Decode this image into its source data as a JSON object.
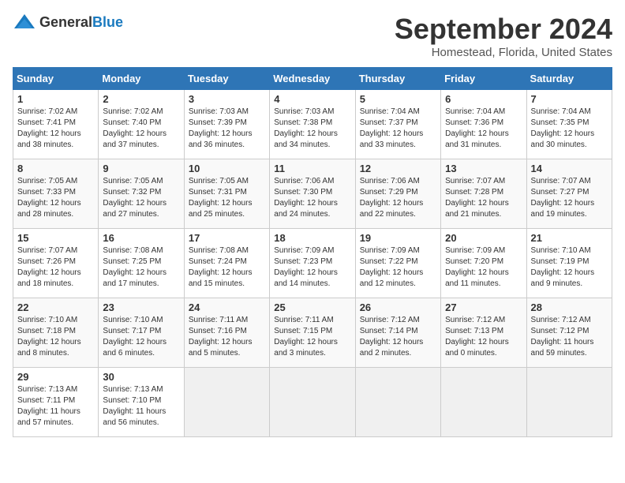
{
  "header": {
    "logo_general": "General",
    "logo_blue": "Blue",
    "title": "September 2024",
    "subtitle": "Homestead, Florida, United States"
  },
  "calendar": {
    "days_of_week": [
      "Sunday",
      "Monday",
      "Tuesday",
      "Wednesday",
      "Thursday",
      "Friday",
      "Saturday"
    ],
    "weeks": [
      [
        {
          "day": "",
          "empty": true
        },
        {
          "day": "",
          "empty": true
        },
        {
          "day": "",
          "empty": true
        },
        {
          "day": "",
          "empty": true
        },
        {
          "day": "",
          "empty": true
        },
        {
          "day": "",
          "empty": true
        },
        {
          "day": "",
          "empty": true
        }
      ],
      [
        {
          "day": "1",
          "info": "Sunrise: 7:02 AM\nSunset: 7:41 PM\nDaylight: 12 hours\nand 38 minutes."
        },
        {
          "day": "2",
          "info": "Sunrise: 7:02 AM\nSunset: 7:40 PM\nDaylight: 12 hours\nand 37 minutes."
        },
        {
          "day": "3",
          "info": "Sunrise: 7:03 AM\nSunset: 7:39 PM\nDaylight: 12 hours\nand 36 minutes."
        },
        {
          "day": "4",
          "info": "Sunrise: 7:03 AM\nSunset: 7:38 PM\nDaylight: 12 hours\nand 34 minutes."
        },
        {
          "day": "5",
          "info": "Sunrise: 7:04 AM\nSunset: 7:37 PM\nDaylight: 12 hours\nand 33 minutes."
        },
        {
          "day": "6",
          "info": "Sunrise: 7:04 AM\nSunset: 7:36 PM\nDaylight: 12 hours\nand 31 minutes."
        },
        {
          "day": "7",
          "info": "Sunrise: 7:04 AM\nSunset: 7:35 PM\nDaylight: 12 hours\nand 30 minutes."
        }
      ],
      [
        {
          "day": "8",
          "info": "Sunrise: 7:05 AM\nSunset: 7:33 PM\nDaylight: 12 hours\nand 28 minutes."
        },
        {
          "day": "9",
          "info": "Sunrise: 7:05 AM\nSunset: 7:32 PM\nDaylight: 12 hours\nand 27 minutes."
        },
        {
          "day": "10",
          "info": "Sunrise: 7:05 AM\nSunset: 7:31 PM\nDaylight: 12 hours\nand 25 minutes."
        },
        {
          "day": "11",
          "info": "Sunrise: 7:06 AM\nSunset: 7:30 PM\nDaylight: 12 hours\nand 24 minutes."
        },
        {
          "day": "12",
          "info": "Sunrise: 7:06 AM\nSunset: 7:29 PM\nDaylight: 12 hours\nand 22 minutes."
        },
        {
          "day": "13",
          "info": "Sunrise: 7:07 AM\nSunset: 7:28 PM\nDaylight: 12 hours\nand 21 minutes."
        },
        {
          "day": "14",
          "info": "Sunrise: 7:07 AM\nSunset: 7:27 PM\nDaylight: 12 hours\nand 19 minutes."
        }
      ],
      [
        {
          "day": "15",
          "info": "Sunrise: 7:07 AM\nSunset: 7:26 PM\nDaylight: 12 hours\nand 18 minutes."
        },
        {
          "day": "16",
          "info": "Sunrise: 7:08 AM\nSunset: 7:25 PM\nDaylight: 12 hours\nand 17 minutes."
        },
        {
          "day": "17",
          "info": "Sunrise: 7:08 AM\nSunset: 7:24 PM\nDaylight: 12 hours\nand 15 minutes."
        },
        {
          "day": "18",
          "info": "Sunrise: 7:09 AM\nSunset: 7:23 PM\nDaylight: 12 hours\nand 14 minutes."
        },
        {
          "day": "19",
          "info": "Sunrise: 7:09 AM\nSunset: 7:22 PM\nDaylight: 12 hours\nand 12 minutes."
        },
        {
          "day": "20",
          "info": "Sunrise: 7:09 AM\nSunset: 7:20 PM\nDaylight: 12 hours\nand 11 minutes."
        },
        {
          "day": "21",
          "info": "Sunrise: 7:10 AM\nSunset: 7:19 PM\nDaylight: 12 hours\nand 9 minutes."
        }
      ],
      [
        {
          "day": "22",
          "info": "Sunrise: 7:10 AM\nSunset: 7:18 PM\nDaylight: 12 hours\nand 8 minutes."
        },
        {
          "day": "23",
          "info": "Sunrise: 7:10 AM\nSunset: 7:17 PM\nDaylight: 12 hours\nand 6 minutes."
        },
        {
          "day": "24",
          "info": "Sunrise: 7:11 AM\nSunset: 7:16 PM\nDaylight: 12 hours\nand 5 minutes."
        },
        {
          "day": "25",
          "info": "Sunrise: 7:11 AM\nSunset: 7:15 PM\nDaylight: 12 hours\nand 3 minutes."
        },
        {
          "day": "26",
          "info": "Sunrise: 7:12 AM\nSunset: 7:14 PM\nDaylight: 12 hours\nand 2 minutes."
        },
        {
          "day": "27",
          "info": "Sunrise: 7:12 AM\nSunset: 7:13 PM\nDaylight: 12 hours\nand 0 minutes."
        },
        {
          "day": "28",
          "info": "Sunrise: 7:12 AM\nSunset: 7:12 PM\nDaylight: 11 hours\nand 59 minutes."
        }
      ],
      [
        {
          "day": "29",
          "info": "Sunrise: 7:13 AM\nSunset: 7:11 PM\nDaylight: 11 hours\nand 57 minutes."
        },
        {
          "day": "30",
          "info": "Sunrise: 7:13 AM\nSunset: 7:10 PM\nDaylight: 11 hours\nand 56 minutes."
        },
        {
          "day": "",
          "empty": true
        },
        {
          "day": "",
          "empty": true
        },
        {
          "day": "",
          "empty": true
        },
        {
          "day": "",
          "empty": true
        },
        {
          "day": "",
          "empty": true
        }
      ]
    ]
  }
}
